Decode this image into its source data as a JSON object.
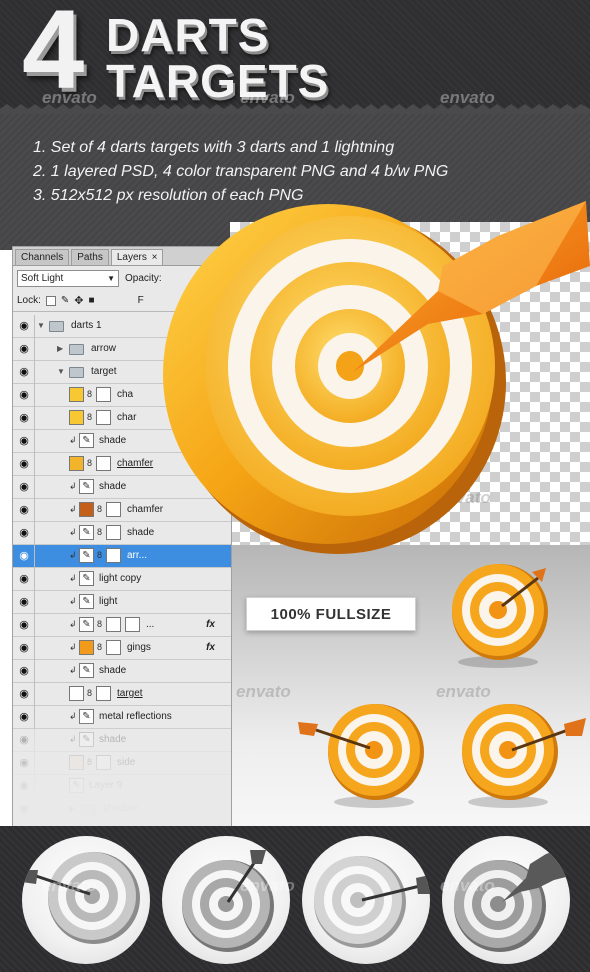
{
  "header": {
    "number": "4",
    "title_line1": "DARTS",
    "title_line2": "TARGETS",
    "features": [
      "1. Set of 4 darts targets with 3 darts and 1 lightning",
      "2. 1 layered PSD, 4 color transparent PNG and 4 b/w PNG",
      "3. 512x512 px resolution of each PNG"
    ]
  },
  "watermark": "envato",
  "layers_panel": {
    "tabs": [
      "Channels",
      "Paths",
      "Layers"
    ],
    "active_tab": "Layers",
    "close_glyph": "×",
    "blend_mode": "Soft Light",
    "opacity_label": "Opacity:",
    "lock_label": "Lock:",
    "fill_label": "F",
    "rows": [
      {
        "name": "darts 1"
      },
      {
        "name": "arrow"
      },
      {
        "name": "target"
      },
      {
        "name": "cha"
      },
      {
        "name": "char"
      },
      {
        "name": "shade"
      },
      {
        "name": "chamfer"
      },
      {
        "name": "shade"
      },
      {
        "name": "chamfer"
      },
      {
        "name": "shade"
      },
      {
        "name": "arr..."
      },
      {
        "name": "light copy"
      },
      {
        "name": "light"
      },
      {
        "name": "..."
      },
      {
        "name": "gings"
      },
      {
        "name": "shade"
      },
      {
        "name": "target"
      },
      {
        "name": "metal reflections"
      },
      {
        "name": "shade"
      },
      {
        "name": "side"
      },
      {
        "name": "Layer 9"
      },
      {
        "name": "shadow"
      }
    ],
    "fx_label": "fx"
  },
  "badge": {
    "label": "100% FULLSIZE"
  },
  "colors": {
    "header_bg": "#2f2f31",
    "orange": "#f29a1a",
    "gold": "#f5b52a",
    "selected_row": "#3d8ee0"
  }
}
